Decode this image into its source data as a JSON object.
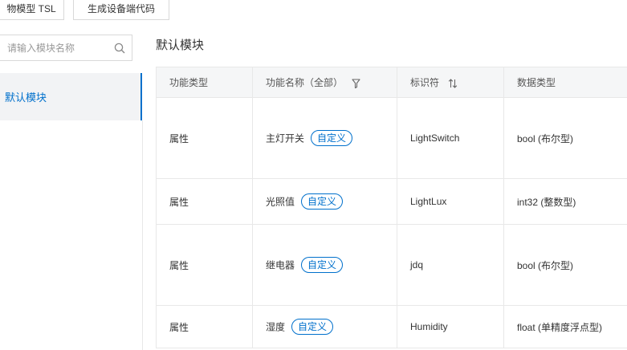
{
  "top_buttons": {
    "tsl": "物模型 TSL",
    "generate_code": "生成设备端代码"
  },
  "sidebar": {
    "search_placeholder": "请输入模块名称",
    "search_icon": "search-icon",
    "items": [
      {
        "label": "默认模块",
        "active": true
      }
    ]
  },
  "main": {
    "section_title": "默认模块",
    "table": {
      "columns": [
        {
          "label": "功能类型"
        },
        {
          "label": "功能名称（全部）",
          "icon": "filter-icon"
        },
        {
          "label": "标识符",
          "icon": "sort-icon"
        },
        {
          "label": "数据类型"
        }
      ],
      "rows": [
        {
          "type": "属性",
          "name": "主灯开关",
          "tag": "自定义",
          "identifier": "LightSwitch",
          "data_type": "bool (布尔型)"
        },
        {
          "type": "属性",
          "name": "光照值",
          "tag": "自定义",
          "identifier": "LightLux",
          "data_type": "int32 (整数型)"
        },
        {
          "type": "属性",
          "name": "继电器",
          "tag": "自定义",
          "identifier": "jdq",
          "data_type": "bool (布尔型)"
        },
        {
          "type": "属性",
          "name": "湿度",
          "tag": "自定义",
          "identifier": "Humidity",
          "data_type": "float (单精度浮点型)"
        }
      ]
    }
  },
  "colors": {
    "accent": "#0070cc",
    "header_bg": "#f5f6f7",
    "sidebar_active_bg": "#f2f3f5",
    "border": "#e8e8e8"
  }
}
